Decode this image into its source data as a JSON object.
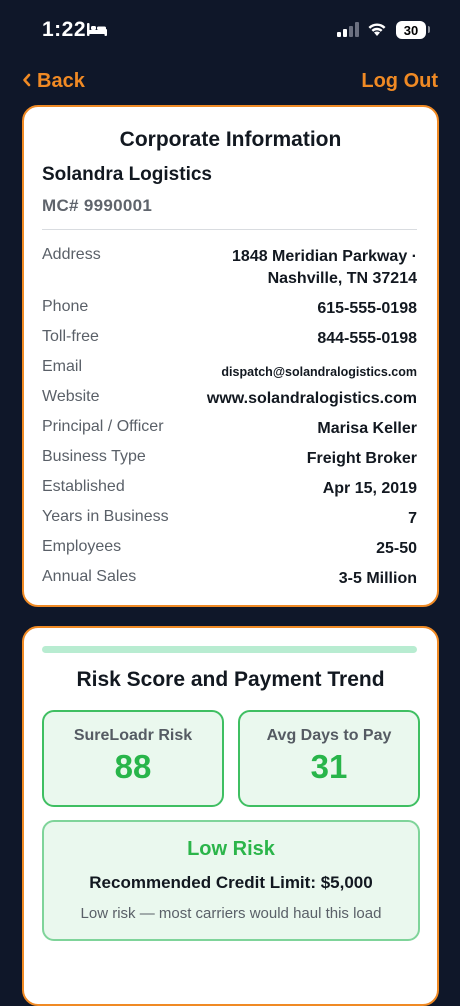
{
  "status_bar": {
    "time": "1:22",
    "battery": "30",
    "icons": [
      "bed-icon",
      "signal-icon",
      "wifi-icon",
      "battery-icon"
    ]
  },
  "nav": {
    "back_label": "Back",
    "logout_label": "Log Out",
    "accent_color": "#f08a24"
  },
  "corporate": {
    "title": "Corporate Information",
    "company_name": "Solandra Logistics",
    "mc_number": "MC# 9990001",
    "rows": [
      {
        "label": "Address",
        "value": "1848 Meridian Parkway ·",
        "value2": "Nashville, TN 37214"
      },
      {
        "label": "Phone",
        "value": "615-555-0198"
      },
      {
        "label": "Toll-free",
        "value": "844-555-0198"
      },
      {
        "label": "Email",
        "value": "dispatch@solandralogistics.com"
      },
      {
        "label": "Website",
        "value": "www.solandralogistics.com"
      },
      {
        "label": "Principal / Officer",
        "value": "Marisa Keller"
      },
      {
        "label": "Business Type",
        "value": "Freight Broker"
      },
      {
        "label": "Established",
        "value": "Apr 15, 2019"
      },
      {
        "label": "Years in Business",
        "value": "7"
      },
      {
        "label": "Employees",
        "value": "25-50"
      },
      {
        "label": "Annual Sales",
        "value": "3-5 Million"
      }
    ]
  },
  "risk": {
    "title": "Risk Score and Payment Trend",
    "score_label": "SureLoadr Risk",
    "score_value": "88",
    "days_label": "Avg Days to Pay",
    "days_value": "31",
    "level": "Low Risk",
    "credit_limit": "Recommended Credit Limit: $5,000",
    "note": "Low risk — most carriers would haul this load",
    "accent_color": "#28b54a"
  }
}
